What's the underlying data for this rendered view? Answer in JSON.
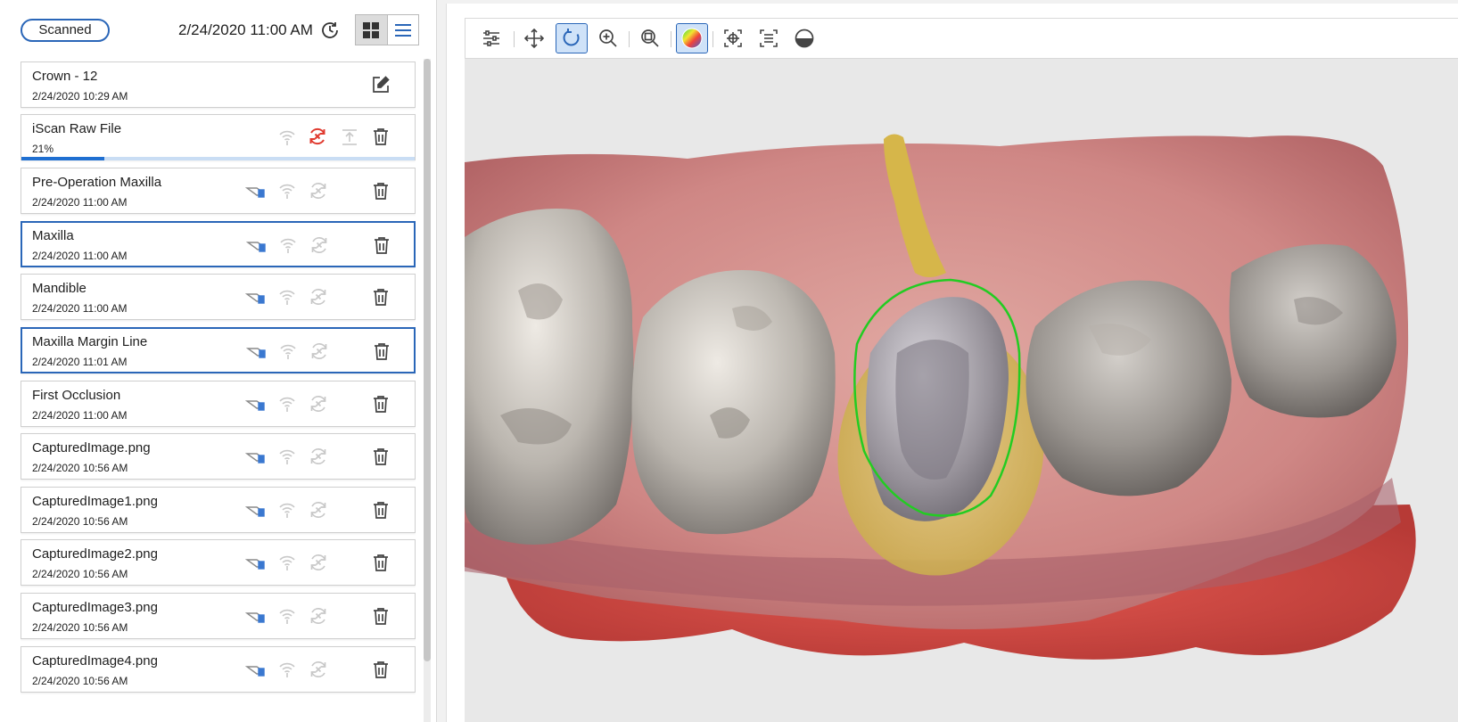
{
  "header": {
    "status_pill": "Scanned",
    "datetime": "2/24/2020 11:00 AM"
  },
  "items": [
    {
      "title": "Crown - 12",
      "subtitle": "2/24/2020 10:29 AM"
    },
    {
      "title": "iScan Raw File",
      "subtitle": "21%",
      "progress": 0.21
    },
    {
      "title": "Pre-Operation Maxilla",
      "subtitle": "2/24/2020 11:00 AM"
    },
    {
      "title": "Maxilla",
      "subtitle": "2/24/2020 11:00 AM"
    },
    {
      "title": "Mandible",
      "subtitle": "2/24/2020 11:00 AM"
    },
    {
      "title": "Maxilla Margin Line",
      "subtitle": "2/24/2020 11:01 AM"
    },
    {
      "title": "First Occlusion",
      "subtitle": "2/24/2020 11:00 AM"
    },
    {
      "title": "CapturedImage.png",
      "subtitle": "2/24/2020 10:56 AM"
    },
    {
      "title": "CapturedImage1.png",
      "subtitle": "2/24/2020 10:56 AM"
    },
    {
      "title": "CapturedImage2.png",
      "subtitle": "2/24/2020 10:56 AM"
    },
    {
      "title": "CapturedImage3.png",
      "subtitle": "2/24/2020 10:56 AM"
    },
    {
      "title": "CapturedImage4.png",
      "subtitle": "2/24/2020 10:56 AM"
    }
  ],
  "toolbar_icons": [
    "sliders-icon",
    "move-icon",
    "rotate-icon",
    "zoom-in-icon",
    "zoom-fit-icon",
    "color-map-icon",
    "focus-target-icon",
    "select-area-icon",
    "half-circle-icon"
  ],
  "colors": {
    "accent": "#2a66b8",
    "progress": "#1f6fd1",
    "error_red": "#e03a2f",
    "margin_line": "#22cc22",
    "gum": "#c9777a",
    "preparation": "#d9b84a"
  }
}
